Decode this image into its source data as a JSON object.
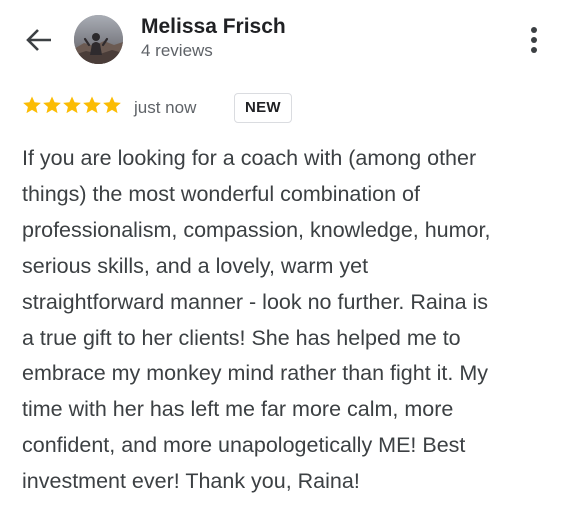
{
  "header": {
    "back_icon": "arrow-back-icon",
    "reviewer_name": "Melissa Frisch",
    "review_count": "4 reviews",
    "more_icon": "more-vertical-icon"
  },
  "review": {
    "rating": 5,
    "rating_max": 5,
    "star_color": "#fbbc04",
    "time": "just now",
    "badge": "NEW",
    "lines": [
      "If you are looking for a coach with (among other",
      "things) the most wonderful combination of",
      "professionalism, compassion, knowledge, humor,",
      "serious skills, and a lovely, warm yet",
      "straightforward manner - look no further. Raina is",
      "a true gift to her clients! She has helped me to",
      "embrace my monkey mind rather than fight it. My",
      "time with her has left me far more calm, more",
      "confident, and more unapologetically ME! Best",
      "investment ever! Thank you, Raina!"
    ]
  }
}
